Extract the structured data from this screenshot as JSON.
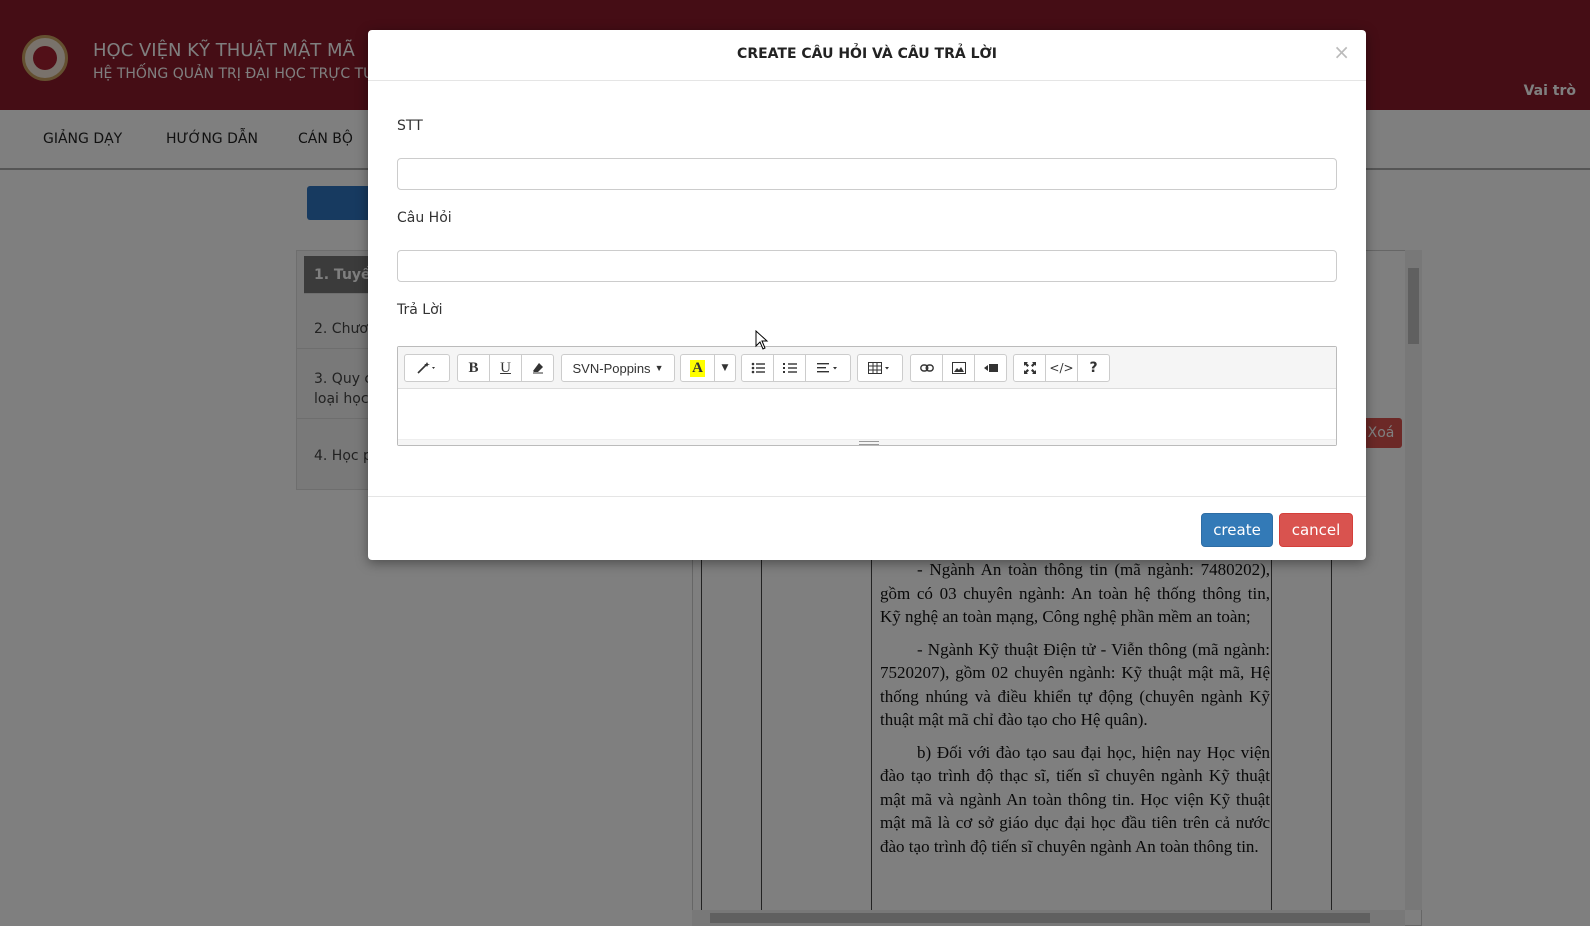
{
  "header": {
    "title": "HỌC VIỆN KỸ THUẬT MẬT MÃ",
    "subtitle": "HỆ THỐNG QUẢN TRỊ ĐẠI HỌC TRỰC TU",
    "role_link": "Vai trò"
  },
  "nav": {
    "items": [
      "GIẢNG DẠY",
      "HƯỚNG DẪN",
      "CÁN BỘ"
    ]
  },
  "side_panel": {
    "items": [
      {
        "label": "1. Tuyển",
        "active": true
      },
      {
        "label": "2. Chươ"
      },
      {
        "label": "3. Quy c",
        "label2": "loại học"
      },
      {
        "label": "4. Học p"
      }
    ]
  },
  "document": {
    "paragraphs": [
      "- Ngành An toàn thông tin (mã ngành: 7480202), gồm có 03 chuyên ngành: An toàn hệ thống thông tin, Kỹ nghệ an toàn mạng, Công nghệ phần mềm an toàn;",
      "- Ngành Kỹ thuật Điện tử - Viễn thông (mã ngành: 7520207), gồm 02 chuyên ngành: Kỹ thuật mật mã, Hệ thống nhúng và điều khiển tự động (chuyên ngành Kỹ thuật mật mã chỉ đào tạo cho Hệ quân).",
      "b) Đối với đào tạo sau đại học, hiện nay Học viện đào tạo trình độ thạc sĩ, tiến sĩ chuyên ngành Kỹ thuật mật mã và ngành An toàn thông tin. Học viện Kỹ thuật mật mã là cơ sở giáo dục đại học đầu tiên trên cả nước đào tạo trình độ tiến sĩ chuyên ngành An toàn thông tin."
    ],
    "delete_label": "Xoá"
  },
  "modal": {
    "title": "CREATE CÂU HỎI VÀ CÂU TRẢ LỜI",
    "close": "×",
    "fields": {
      "stt_label": "STT",
      "stt_value": "",
      "question_label": "Câu Hỏi",
      "question_value": "",
      "answer_label": "Trả Lời",
      "answer_value": ""
    },
    "toolbar": {
      "style": "magic-wand-icon",
      "bold": "B",
      "underline": "U",
      "clear": "eraser-icon",
      "font": "SVN-Poppins",
      "color": "A",
      "ul": "bullet-list-icon",
      "ol": "numbered-list-icon",
      "align": "align-icon",
      "table": "table-icon",
      "link": "link-icon",
      "picture": "image-icon",
      "video": "video-icon",
      "fullscreen": "fullscreen-icon",
      "code": "</>",
      "help": "?"
    },
    "buttons": {
      "create": "create",
      "cancel": "cancel"
    }
  },
  "colors": {
    "header_bg": "#8b1a2a",
    "primary": "#337ab7",
    "danger": "#d9534f"
  }
}
